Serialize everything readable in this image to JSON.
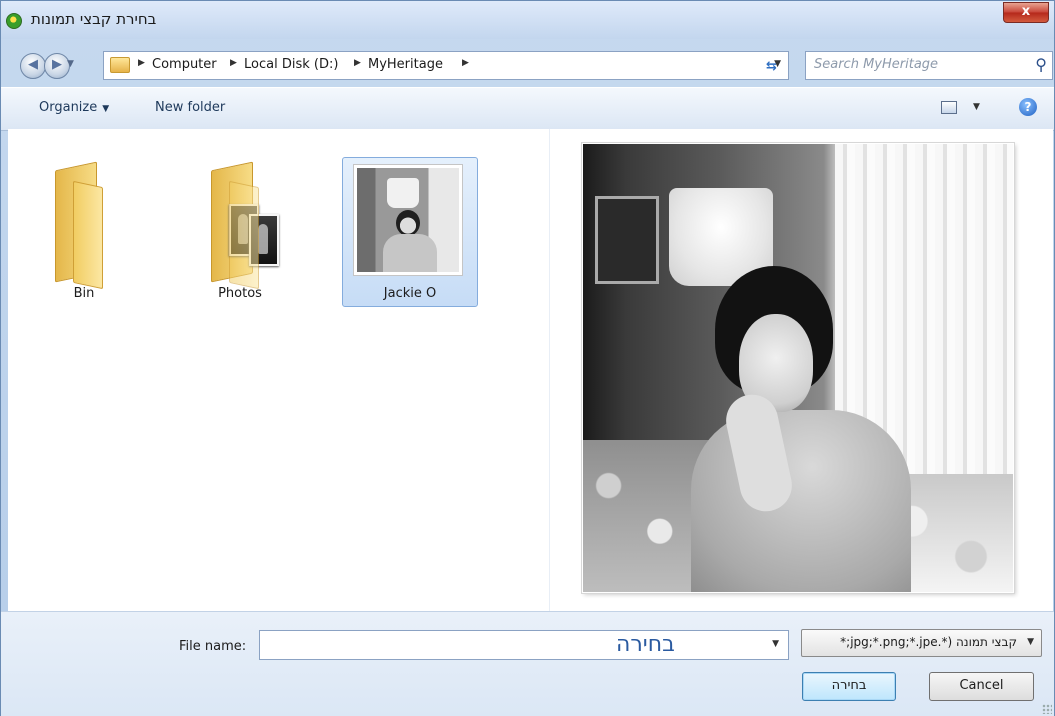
{
  "window": {
    "title": "בחירת קבצי תמונות",
    "close_label": "x"
  },
  "address_bar": {
    "breadcrumbs": [
      "Computer",
      "Local Disk (D:)",
      "MyHeritage"
    ],
    "search_placeholder": "Search MyHeritage"
  },
  "toolbar": {
    "organize_label": "Organize",
    "new_folder_label": "New folder"
  },
  "items": [
    {
      "label": "Bin",
      "type": "folder"
    },
    {
      "label": "Photos",
      "type": "folder"
    },
    {
      "label": "Jackie O",
      "type": "image",
      "selected": true
    }
  ],
  "bottom": {
    "file_name_label": "File name:",
    "file_name_value": "בחירה",
    "file_type_value": "קבצי תמונה (*.jpg;*.png;*.jpe;*",
    "open_label": "בחירה",
    "cancel_label": "Cancel"
  },
  "icons": {
    "app": "app-logo-icon",
    "back": "back-arrow-icon",
    "forward": "forward-arrow-icon",
    "folder": "folder-icon",
    "refresh": "refresh-icon",
    "search": "search-icon",
    "view": "view-mode-icon",
    "help": "help-icon"
  },
  "colors": {
    "selection": "#cde1f7",
    "window_frame": "#b5cde9",
    "primary_button": "#bee6fd"
  }
}
